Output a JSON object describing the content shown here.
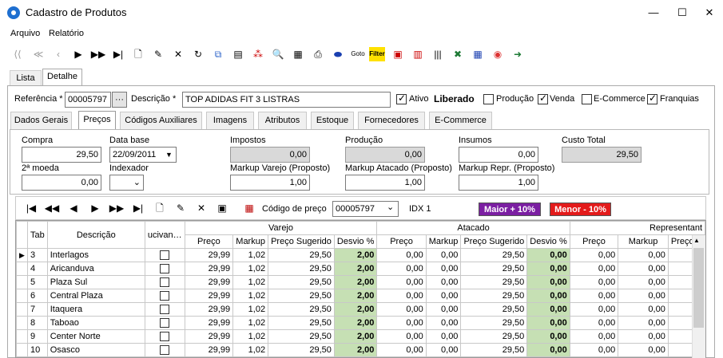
{
  "window": {
    "title": "Cadastro de Produtos",
    "minimize": "—",
    "maximize": "☐",
    "close": "✕"
  },
  "menu": [
    "Arquivo",
    "Relatório"
  ],
  "top_tabs": [
    "Lista",
    "Detalhe"
  ],
  "header": {
    "referencia_label": "Referência *",
    "referencia_value": "00005797",
    "dots": "···",
    "descricao_label": "Descrição *",
    "descricao_value": "TOP ADIDAS FIT 3 LISTRAS",
    "ativo_label": "Ativo",
    "liberado_label": "Liberado",
    "producao_label": "Produção",
    "venda_label": "Venda",
    "ecommerce_label": "E-Commerce",
    "franquias_label": "Franquias"
  },
  "sub_tabs": [
    "Dados Gerais",
    "Preços",
    "Códigos Auxiliares",
    "Imagens",
    "Atributos",
    "Estoque",
    "Fornecedores",
    "E-Commerce"
  ],
  "precos": {
    "compra_label": "Compra",
    "compra_value": "29,50",
    "database_label": "Data base",
    "database_value": "22/09/2011",
    "impostos_label": "Impostos",
    "impostos_value": "0,00",
    "producao_label": "Produção",
    "producao_value": "0,00",
    "insumos_label": "Insumos",
    "insumos_value": "0,00",
    "custo_label": "Custo Total",
    "custo_value": "29,50",
    "moeda_label": "2ª moeda",
    "moeda_value": "0,00",
    "indexador_label": "Indexador",
    "mkv_label": "Markup Varejo (Proposto)",
    "mkv_value": "1,00",
    "mka_label": "Markup Atacado (Proposto)",
    "mka_value": "1,00",
    "mkr_label": "Markup Repr. (Proposto)",
    "mkr_value": "1,00"
  },
  "grid_toolbar": {
    "codigo_label": "Código de preço",
    "codigo_value": "00005797",
    "idx_label": "IDX 1",
    "maior_label": "Maior + 10%",
    "menor_label": "Menor - 10%",
    "maior_color": "#7b1fa2",
    "menor_color": "#e31b1b"
  },
  "grid": {
    "groups": [
      "Varejo",
      "Atacado",
      "Representant"
    ],
    "headers": [
      "Tab",
      "Descrição",
      "ucivan…",
      "Preço",
      "Markup",
      "Preço Sugerido",
      "Desvio %",
      "Preço",
      "Markup",
      "Preço Sugerido",
      "Desvio %",
      "Preço",
      "Markup",
      "Preço S"
    ],
    "rows": [
      [
        "3",
        "Interlagos",
        "29,99",
        "1,02",
        "29,50",
        "2,00",
        "0,00",
        "0,00",
        "29,50",
        "0,00",
        "0,00",
        "0,00"
      ],
      [
        "4",
        "Aricanduva",
        "29,99",
        "1,02",
        "29,50",
        "2,00",
        "0,00",
        "0,00",
        "29,50",
        "0,00",
        "0,00",
        "0,00"
      ],
      [
        "5",
        "Plaza Sul",
        "29,99",
        "1,02",
        "29,50",
        "2,00",
        "0,00",
        "0,00",
        "29,50",
        "0,00",
        "0,00",
        "0,00"
      ],
      [
        "6",
        "Central Plaza",
        "29,99",
        "1,02",
        "29,50",
        "2,00",
        "0,00",
        "0,00",
        "29,50",
        "0,00",
        "0,00",
        "0,00"
      ],
      [
        "7",
        "Itaquera",
        "29,99",
        "1,02",
        "29,50",
        "2,00",
        "0,00",
        "0,00",
        "29,50",
        "0,00",
        "0,00",
        "0,00"
      ],
      [
        "8",
        "Taboao",
        "29,99",
        "1,02",
        "29,50",
        "2,00",
        "0,00",
        "0,00",
        "29,50",
        "0,00",
        "0,00",
        "0,00"
      ],
      [
        "9",
        "Center Norte",
        "29,99",
        "1,02",
        "29,50",
        "2,00",
        "0,00",
        "0,00",
        "29,50",
        "0,00",
        "0,00",
        "0,00"
      ],
      [
        "10",
        "Osasco",
        "29,99",
        "1,02",
        "29,50",
        "2,00",
        "0,00",
        "0,00",
        "29,50",
        "0,00",
        "0,00",
        "0,00"
      ]
    ]
  }
}
